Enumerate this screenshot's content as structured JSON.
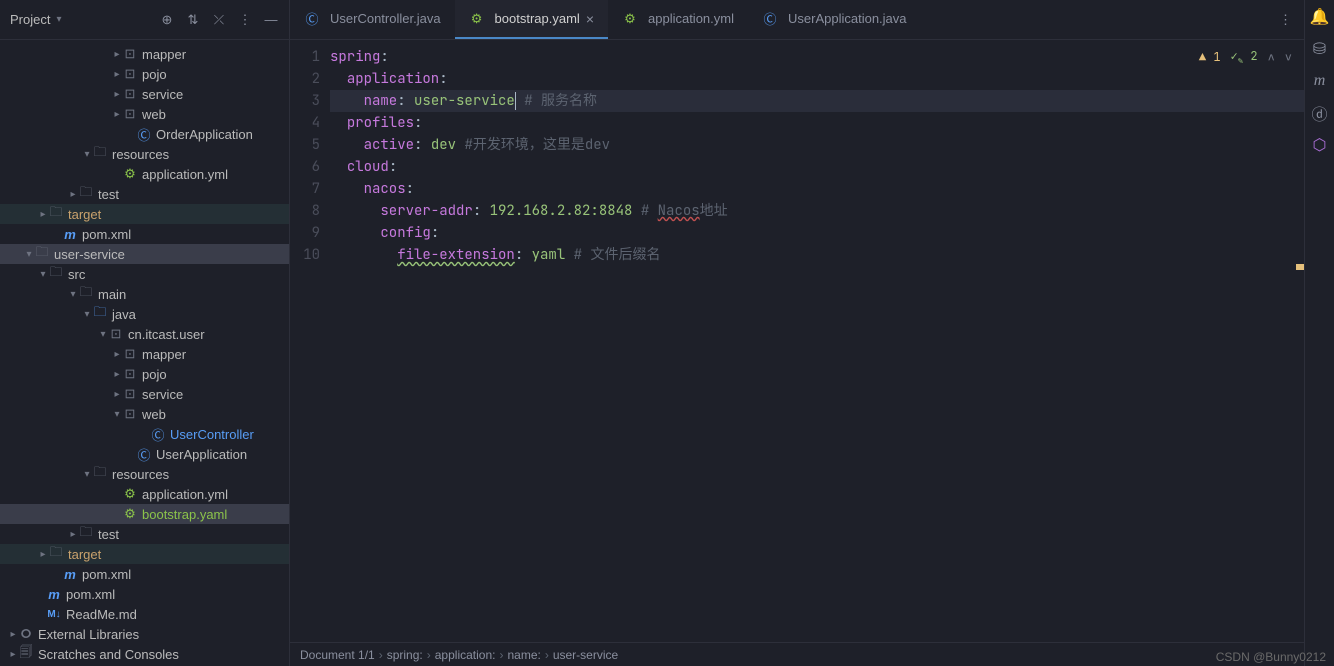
{
  "sidebar": {
    "title": "Project",
    "nodes": [
      {
        "indent": 112,
        "arrow": "closed",
        "icon": "folder-dot",
        "label": "mapper"
      },
      {
        "indent": 112,
        "arrow": "closed",
        "icon": "folder-dot",
        "label": "pojo"
      },
      {
        "indent": 112,
        "arrow": "closed",
        "icon": "folder-dot",
        "label": "service"
      },
      {
        "indent": 112,
        "arrow": "closed",
        "icon": "folder-dot",
        "label": "web"
      },
      {
        "indent": 126,
        "arrow": "",
        "icon": "java-app",
        "label": "OrderApplication"
      },
      {
        "indent": 82,
        "arrow": "open",
        "icon": "folder-res",
        "label": "resources"
      },
      {
        "indent": 112,
        "arrow": "",
        "icon": "yaml",
        "label": "application.yml"
      },
      {
        "indent": 68,
        "arrow": "closed",
        "icon": "folder",
        "label": "test"
      },
      {
        "indent": 38,
        "arrow": "closed",
        "icon": "folder",
        "label": "target",
        "orange": true,
        "highlight": true
      },
      {
        "indent": 52,
        "arrow": "",
        "icon": "pom",
        "label": "pom.xml"
      },
      {
        "indent": 24,
        "arrow": "open",
        "icon": "folder",
        "label": "user-service",
        "selected": true
      },
      {
        "indent": 38,
        "arrow": "open",
        "icon": "folder",
        "label": "src"
      },
      {
        "indent": 68,
        "arrow": "open",
        "icon": "folder",
        "label": "main"
      },
      {
        "indent": 82,
        "arrow": "open",
        "icon": "folder-java",
        "label": "java"
      },
      {
        "indent": 98,
        "arrow": "open",
        "icon": "folder-dot",
        "label": "cn.itcast.user"
      },
      {
        "indent": 112,
        "arrow": "closed",
        "icon": "folder-dot",
        "label": "mapper"
      },
      {
        "indent": 112,
        "arrow": "closed",
        "icon": "folder-dot",
        "label": "pojo"
      },
      {
        "indent": 112,
        "arrow": "closed",
        "icon": "folder-dot",
        "label": "service"
      },
      {
        "indent": 112,
        "arrow": "open",
        "icon": "folder-dot",
        "label": "web"
      },
      {
        "indent": 140,
        "arrow": "",
        "icon": "java-class",
        "label": "UserController",
        "blue": true
      },
      {
        "indent": 126,
        "arrow": "",
        "icon": "java-app",
        "label": "UserApplication"
      },
      {
        "indent": 82,
        "arrow": "open",
        "icon": "folder-res",
        "label": "resources"
      },
      {
        "indent": 112,
        "arrow": "",
        "icon": "yaml",
        "label": "application.yml"
      },
      {
        "indent": 112,
        "arrow": "",
        "icon": "yaml",
        "label": "bootstrap.yaml",
        "green": true,
        "selected": true
      },
      {
        "indent": 68,
        "arrow": "closed",
        "icon": "folder",
        "label": "test"
      },
      {
        "indent": 38,
        "arrow": "closed",
        "icon": "folder",
        "label": "target",
        "orange": true,
        "highlight": true
      },
      {
        "indent": 52,
        "arrow": "",
        "icon": "pom",
        "label": "pom.xml"
      },
      {
        "indent": 36,
        "arrow": "",
        "icon": "pom",
        "label": "pom.xml"
      },
      {
        "indent": 36,
        "arrow": "",
        "icon": "md",
        "label": "ReadMe.md"
      },
      {
        "indent": 8,
        "arrow": "closed",
        "icon": "lib",
        "label": "External Libraries"
      },
      {
        "indent": 8,
        "arrow": "closed",
        "icon": "scratch",
        "label": "Scratches and Consoles",
        "cutoff": true
      }
    ]
  },
  "tabs": [
    {
      "icon": "java-class",
      "label": "UserController.java",
      "active": false
    },
    {
      "icon": "yaml",
      "label": "bootstrap.yaml",
      "active": true,
      "closeable": true
    },
    {
      "icon": "yaml",
      "label": "application.yml",
      "active": false
    },
    {
      "icon": "java-app",
      "label": "UserApplication.java",
      "active": false
    }
  ],
  "editor": {
    "warnings": {
      "yellow": "1",
      "green": "2"
    },
    "lines": [
      {
        "n": 1,
        "segs": [
          {
            "t": "spring",
            "c": "key"
          },
          {
            "t": ":",
            "c": ""
          }
        ]
      },
      {
        "n": 2,
        "segs": [
          {
            "t": "  "
          },
          {
            "t": "application",
            "c": "key"
          },
          {
            "t": ":",
            "c": ""
          }
        ]
      },
      {
        "n": 3,
        "cursor": true,
        "segs": [
          {
            "t": "    "
          },
          {
            "t": "name",
            "c": "key"
          },
          {
            "t": ": "
          },
          {
            "t": "user-service",
            "c": "val",
            "cursorAfter": true
          },
          {
            "t": " "
          },
          {
            "t": "# 服务名称",
            "c": "comment"
          }
        ]
      },
      {
        "n": 4,
        "segs": [
          {
            "t": "  "
          },
          {
            "t": "profiles",
            "c": "key"
          },
          {
            "t": ":",
            "c": ""
          }
        ]
      },
      {
        "n": 5,
        "segs": [
          {
            "t": "    "
          },
          {
            "t": "active",
            "c": "key"
          },
          {
            "t": ": "
          },
          {
            "t": "dev",
            "c": "val"
          },
          {
            "t": " "
          },
          {
            "t": "#开发环境，这里是dev",
            "c": "comment"
          }
        ]
      },
      {
        "n": 6,
        "segs": [
          {
            "t": "  "
          },
          {
            "t": "cloud",
            "c": "key"
          },
          {
            "t": ":",
            "c": ""
          }
        ]
      },
      {
        "n": 7,
        "segs": [
          {
            "t": "    "
          },
          {
            "t": "nacos",
            "c": "key"
          },
          {
            "t": ":",
            "c": ""
          }
        ]
      },
      {
        "n": 8,
        "segs": [
          {
            "t": "      "
          },
          {
            "t": "server-addr",
            "c": "key"
          },
          {
            "t": ": "
          },
          {
            "t": "192.168.2.82:8848",
            "c": "val"
          },
          {
            "t": " "
          },
          {
            "t": "# ",
            "c": "comment"
          },
          {
            "t": "Nacos",
            "c": "comment wavy"
          },
          {
            "t": "地址",
            "c": "comment"
          }
        ]
      },
      {
        "n": 9,
        "segs": [
          {
            "t": "      "
          },
          {
            "t": "config",
            "c": "key"
          },
          {
            "t": ":",
            "c": ""
          }
        ]
      },
      {
        "n": 10,
        "segs": [
          {
            "t": "        "
          },
          {
            "t": "file-extension",
            "c": "key squig"
          },
          {
            "t": ": "
          },
          {
            "t": "yaml",
            "c": "val"
          },
          {
            "t": " "
          },
          {
            "t": "# 文件后缀名",
            "c": "comment"
          }
        ]
      }
    ]
  },
  "breadcrumb": [
    "Document 1/1",
    "spring:",
    "application:",
    "name:",
    "user-service"
  ],
  "watermark": "CSDN @Bunny0212"
}
